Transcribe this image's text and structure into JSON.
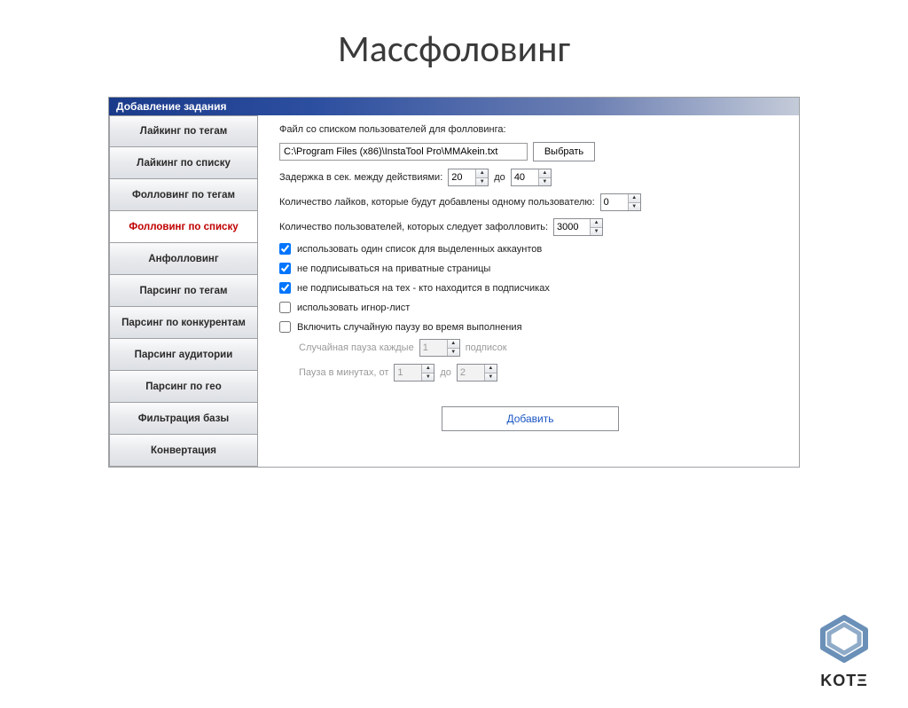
{
  "slide": {
    "title": "Массфоловинг"
  },
  "window": {
    "title": "Добавление задания"
  },
  "sidebar": {
    "items": [
      {
        "label": "Лайкинг по тегам",
        "active": false
      },
      {
        "label": "Лайкинг по списку",
        "active": false
      },
      {
        "label": "Фолловинг по тегам",
        "active": false
      },
      {
        "label": "Фолловинг по списку",
        "active": true
      },
      {
        "label": "Анфолловинг",
        "active": false
      },
      {
        "label": "Парсинг по тегам",
        "active": false
      },
      {
        "label": "Парсинг по конкурентам",
        "active": false
      },
      {
        "label": "Парсинг аудитории",
        "active": false
      },
      {
        "label": "Парсинг по гео",
        "active": false
      },
      {
        "label": "Фильтрация базы",
        "active": false
      },
      {
        "label": "Конвертация",
        "active": false
      }
    ]
  },
  "form": {
    "file_label": "Файл со списком пользователей для фолловинга:",
    "file_value": "C:\\Program Files (x86)\\InstaTool Pro\\MMAkein.txt",
    "choose_btn": "Выбрать",
    "delay_label": "Задержка в сек. между действиями:",
    "delay_from": "20",
    "delay_to_word": "до",
    "delay_to": "40",
    "likes_label": "Количество лайков, которые будут добавлены одному пользователю:",
    "likes_value": "0",
    "users_label": "Количество пользователей, которых следует зафолловить:",
    "users_value": "3000",
    "check1": {
      "checked": true,
      "label": "использовать один список для выделенных аккаунтов"
    },
    "check2": {
      "checked": true,
      "label": "не подписываться на приватные страницы"
    },
    "check3": {
      "checked": true,
      "label": "не подписываться на тех - кто находится в подписчиках"
    },
    "check4": {
      "checked": false,
      "label": "использовать игнор-лист"
    },
    "check5": {
      "checked": false,
      "label": "Включить случайную паузу во время выполнения"
    },
    "random_pause_label": "Случайная пауза каждые",
    "random_pause_every": "1",
    "random_pause_unit": "подписок",
    "pause_min_label": "Пауза в минутах, от",
    "pause_min_from": "1",
    "pause_min_to_word": "до",
    "pause_min_to": "2",
    "submit": "Добавить"
  },
  "brand": {
    "name": "KOTΞ",
    "primary": "#6a90b8",
    "secondary": "#4a6a8e"
  }
}
